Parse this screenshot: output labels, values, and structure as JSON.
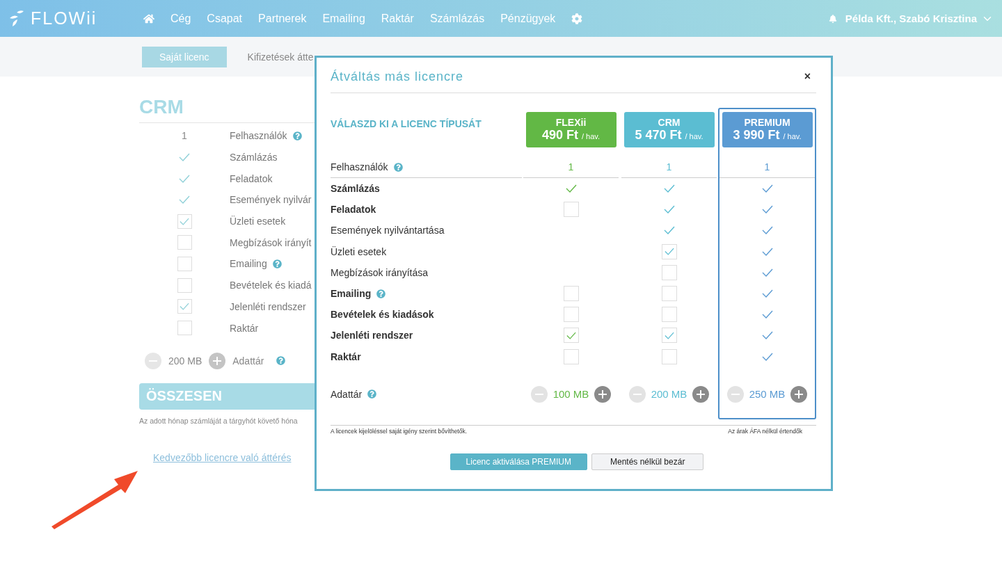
{
  "header": {
    "logo": "FLOWii",
    "nav": [
      "Cég",
      "Csapat",
      "Partnerek",
      "Emailing",
      "Raktár",
      "Számlázás",
      "Pénzügyek"
    ],
    "user": "Példa Kft., Szabó Krisztina"
  },
  "subnav": [
    {
      "label": "Saját licenc",
      "selected": true
    },
    {
      "label": "Kifizetések átte",
      "selected": false
    }
  ],
  "license": {
    "title": "CRM",
    "users": {
      "value": "1",
      "label": "Felhasználók",
      "help": true
    },
    "features": [
      {
        "label": "Számlázás",
        "kind": "check",
        "help": false
      },
      {
        "label": "Feladatok",
        "kind": "check",
        "help": false
      },
      {
        "label": "Események nyilvár",
        "kind": "check",
        "help": false
      },
      {
        "label": "Üzleti esetek",
        "kind": "checkbox",
        "checked": true,
        "help": false
      },
      {
        "label": "Megbízások irányít",
        "kind": "checkbox",
        "checked": false,
        "help": false
      },
      {
        "label": "Emailing",
        "kind": "checkbox",
        "checked": false,
        "help": true
      },
      {
        "label": "Bevételek és kiadá",
        "kind": "checkbox",
        "checked": false,
        "help": false
      },
      {
        "label": "Jelenléti rendszer",
        "kind": "checkbox",
        "checked": true,
        "help": false
      },
      {
        "label": "Raktár",
        "kind": "checkbox",
        "checked": false,
        "help": false
      }
    ],
    "storage": {
      "value": "200 MB",
      "label": "Adattár",
      "help": true
    },
    "total": "ÖSSZESEN",
    "note": "Az adott hónap számláját a tárgyhót követő hóna",
    "link": "Kedvezőbb licencre való áttérés"
  },
  "modal": {
    "title": "Átváltás más licencre",
    "close": "×",
    "heading": "VÁLASZD KI A LICENC TÍPUSÁT",
    "plans": [
      {
        "name": "FLEXii",
        "price": "490 Ft",
        "unit": "/ hav.",
        "color": "#62b845",
        "selected": false,
        "users": "1",
        "storage": "100 MB"
      },
      {
        "name": "CRM",
        "price": "5 470 Ft",
        "unit": "/ hav.",
        "color": "#5bbdd2",
        "selected": false,
        "users": "1",
        "storage": "200 MB"
      },
      {
        "name": "PREMIUM",
        "price": "3 990 Ft",
        "unit": "/ hav.",
        "color": "#5b9bd3",
        "selected": true,
        "users": "1",
        "storage": "250 MB"
      }
    ],
    "users_label": "Felhasználók",
    "users_help": true,
    "features": [
      {
        "label": "Számlázás",
        "bold": true,
        "help": false,
        "cells": [
          {
            "kind": "check"
          },
          {
            "kind": "check"
          },
          {
            "kind": "check"
          }
        ]
      },
      {
        "label": "Feladatok",
        "bold": true,
        "help": false,
        "cells": [
          {
            "kind": "checkbox",
            "checked": false
          },
          {
            "kind": "check"
          },
          {
            "kind": "check"
          }
        ]
      },
      {
        "label": "Események nyilvántartása",
        "bold": false,
        "help": false,
        "cells": [
          {
            "kind": "none"
          },
          {
            "kind": "check"
          },
          {
            "kind": "check"
          }
        ]
      },
      {
        "label": "Üzleti esetek",
        "bold": false,
        "help": false,
        "cells": [
          {
            "kind": "none"
          },
          {
            "kind": "checkbox",
            "checked": true
          },
          {
            "kind": "check"
          }
        ]
      },
      {
        "label": "Megbízások irányítása",
        "bold": false,
        "help": false,
        "cells": [
          {
            "kind": "none"
          },
          {
            "kind": "checkbox",
            "checked": false
          },
          {
            "kind": "check"
          }
        ]
      },
      {
        "label": "Emailing",
        "bold": true,
        "help": true,
        "cells": [
          {
            "kind": "checkbox",
            "checked": false
          },
          {
            "kind": "checkbox",
            "checked": false
          },
          {
            "kind": "check"
          }
        ]
      },
      {
        "label": "Bevételek és kiadások",
        "bold": true,
        "help": false,
        "cells": [
          {
            "kind": "checkbox",
            "checked": false
          },
          {
            "kind": "checkbox",
            "checked": false
          },
          {
            "kind": "check"
          }
        ]
      },
      {
        "label": "Jelenléti rendszer",
        "bold": true,
        "help": false,
        "cells": [
          {
            "kind": "checkbox",
            "checked": true
          },
          {
            "kind": "checkbox",
            "checked": true
          },
          {
            "kind": "check"
          }
        ]
      },
      {
        "label": "Raktár",
        "bold": true,
        "help": false,
        "cells": [
          {
            "kind": "checkbox",
            "checked": false
          },
          {
            "kind": "checkbox",
            "checked": false
          },
          {
            "kind": "check"
          }
        ]
      }
    ],
    "storage_label": "Adattár",
    "storage_help": true,
    "footnote_left": "A licencek kijelöléssel saját igény szerint bővíthetők.",
    "footnote_right": "Az árak ÁFA nélkül értendők",
    "buttons": [
      {
        "label": "Licenc aktiválása PREMIUM",
        "kind": "primary"
      },
      {
        "label": "Mentés nélkül bezár",
        "kind": "secondary"
      }
    ]
  }
}
